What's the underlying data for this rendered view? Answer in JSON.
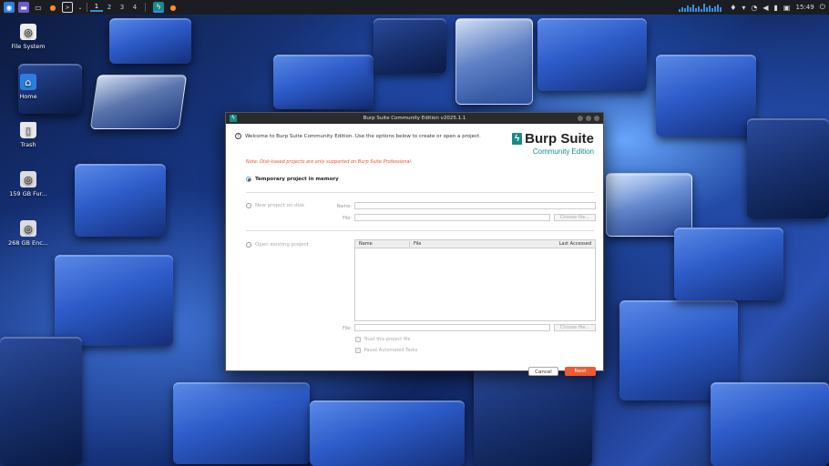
{
  "taskbar": {
    "workspaces": [
      "1",
      "2",
      "3",
      "4"
    ],
    "clock": "15:49"
  },
  "desktop": {
    "icons": [
      {
        "label": "File System"
      },
      {
        "label": "Home"
      },
      {
        "label": "Trash"
      },
      {
        "label": "159 GB Fur..."
      },
      {
        "label": "268 GB Enc..."
      }
    ]
  },
  "dialog": {
    "title": "Burp Suite Community Edition v2025.1.1",
    "welcome": "Welcome to Burp Suite Community Edition. Use the options below to create or open a project.",
    "note": "Note: Disk-based projects are only supported on Burp Suite Professional.",
    "logo_main": "Burp Suite",
    "logo_sub": "Community Edition",
    "options": {
      "temporary": "Temporary project in memory",
      "new_project": "New project on disk",
      "open_existing": "Open existing project"
    },
    "labels": {
      "name": "Name:",
      "file": "File:"
    },
    "choose_file": "Choose file...",
    "table_columns": [
      "Name",
      "File",
      "Last Accessed"
    ],
    "checkboxes": {
      "trust": "Trust this project file",
      "pause": "Pause Automated Tasks"
    },
    "buttons": {
      "cancel": "Cancel",
      "next": "Next"
    }
  }
}
